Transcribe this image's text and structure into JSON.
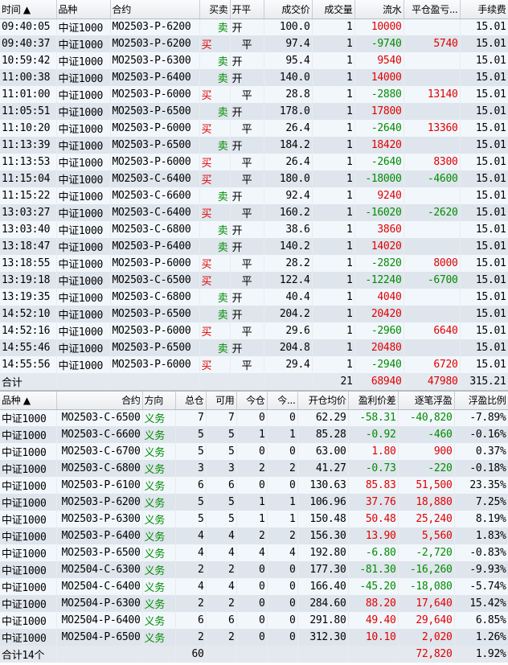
{
  "trades": {
    "headers": [
      "时间 ▲",
      "品种",
      "合约",
      "买卖",
      "开平",
      "成交价",
      "成交量",
      "流水",
      "平仓盈亏...",
      "手续费"
    ],
    "rows": [
      [
        "09:40:05",
        "中证1000",
        "MO2503-P-6200",
        "卖",
        "开",
        "100.0",
        "1",
        "10000",
        "",
        "15.01"
      ],
      [
        "09:40:37",
        "中证1000",
        "MO2503-P-6200",
        "买",
        "平",
        "97.4",
        "1",
        "-9740",
        "5740",
        "15.01"
      ],
      [
        "10:59:42",
        "中证1000",
        "MO2503-P-6300",
        "卖",
        "开",
        "95.4",
        "1",
        "9540",
        "",
        "15.01"
      ],
      [
        "11:00:38",
        "中证1000",
        "MO2503-P-6400",
        "卖",
        "开",
        "140.0",
        "1",
        "14000",
        "",
        "15.01"
      ],
      [
        "11:01:00",
        "中证1000",
        "MO2503-P-6000",
        "买",
        "平",
        "28.8",
        "1",
        "-2880",
        "13140",
        "15.01"
      ],
      [
        "11:05:51",
        "中证1000",
        "MO2503-P-6500",
        "卖",
        "开",
        "178.0",
        "1",
        "17800",
        "",
        "15.01"
      ],
      [
        "11:10:20",
        "中证1000",
        "MO2503-P-6000",
        "买",
        "平",
        "26.4",
        "1",
        "-2640",
        "13360",
        "15.01"
      ],
      [
        "11:13:39",
        "中证1000",
        "MO2503-P-6500",
        "卖",
        "开",
        "184.2",
        "1",
        "18420",
        "",
        "15.01"
      ],
      [
        "11:13:53",
        "中证1000",
        "MO2503-P-6000",
        "买",
        "平",
        "26.4",
        "1",
        "-2640",
        "8300",
        "15.01"
      ],
      [
        "11:15:04",
        "中证1000",
        "MO2503-C-6400",
        "买",
        "平",
        "180.0",
        "1",
        "-18000",
        "-4600",
        "15.01"
      ],
      [
        "11:15:22",
        "中证1000",
        "MO2503-C-6600",
        "卖",
        "开",
        "92.4",
        "1",
        "9240",
        "",
        "15.01"
      ],
      [
        "13:03:27",
        "中证1000",
        "MO2503-C-6400",
        "买",
        "平",
        "160.2",
        "1",
        "-16020",
        "-2620",
        "15.01"
      ],
      [
        "13:03:40",
        "中证1000",
        "MO2503-C-6800",
        "卖",
        "开",
        "38.6",
        "1",
        "3860",
        "",
        "15.01"
      ],
      [
        "13:18:47",
        "中证1000",
        "MO2503-P-6400",
        "卖",
        "开",
        "140.2",
        "1",
        "14020",
        "",
        "15.01"
      ],
      [
        "13:18:55",
        "中证1000",
        "MO2503-P-6000",
        "买",
        "平",
        "28.2",
        "1",
        "-2820",
        "8000",
        "15.01"
      ],
      [
        "13:19:18",
        "中证1000",
        "MO2503-C-6500",
        "买",
        "平",
        "122.4",
        "1",
        "-12240",
        "-6700",
        "15.01"
      ],
      [
        "13:19:35",
        "中证1000",
        "MO2503-C-6800",
        "卖",
        "开",
        "40.4",
        "1",
        "4040",
        "",
        "15.01"
      ],
      [
        "14:52:10",
        "中证1000",
        "MO2503-P-6500",
        "卖",
        "开",
        "204.2",
        "1",
        "20420",
        "",
        "15.01"
      ],
      [
        "14:52:16",
        "中证1000",
        "MO2503-P-6000",
        "买",
        "平",
        "29.6",
        "1",
        "-2960",
        "6640",
        "15.01"
      ],
      [
        "14:55:46",
        "中证1000",
        "MO2503-P-6500",
        "卖",
        "开",
        "204.8",
        "1",
        "20480",
        "",
        "15.01"
      ],
      [
        "14:55:56",
        "中证1000",
        "MO2503-P-6000",
        "买",
        "平",
        "29.4",
        "1",
        "-2940",
        "6720",
        "15.01"
      ]
    ],
    "total": [
      "合计",
      "",
      "",
      "",
      "",
      "",
      "21",
      "68940",
      "47980",
      "315.21"
    ]
  },
  "positions": {
    "headers": [
      "品种 ▲",
      "合约",
      "方向",
      "总仓",
      "可用",
      "今仓",
      "今...",
      "开仓均价",
      "盈利价差",
      "逐笔浮盈",
      "浮盈比例"
    ],
    "rows": [
      [
        "中证1000",
        "MO2503-C-6500",
        "义务",
        "7",
        "7",
        "0",
        "0",
        "62.29",
        "-58.31",
        "-40,820",
        "-7.89%"
      ],
      [
        "中证1000",
        "MO2503-C-6600",
        "义务",
        "5",
        "5",
        "1",
        "1",
        "85.28",
        "-0.92",
        "-460",
        "-0.16%"
      ],
      [
        "中证1000",
        "MO2503-C-6700",
        "义务",
        "5",
        "5",
        "0",
        "0",
        "63.00",
        "1.80",
        "900",
        "0.37%"
      ],
      [
        "中证1000",
        "MO2503-C-6800",
        "义务",
        "3",
        "3",
        "2",
        "2",
        "41.27",
        "-0.73",
        "-220",
        "-0.18%"
      ],
      [
        "中证1000",
        "MO2503-P-6100",
        "义务",
        "6",
        "6",
        "0",
        "0",
        "130.63",
        "85.83",
        "51,500",
        "23.35%"
      ],
      [
        "中证1000",
        "MO2503-P-6200",
        "义务",
        "5",
        "5",
        "1",
        "1",
        "106.96",
        "37.76",
        "18,880",
        "7.25%"
      ],
      [
        "中证1000",
        "MO2503-P-6300",
        "义务",
        "5",
        "5",
        "1",
        "1",
        "150.48",
        "50.48",
        "25,240",
        "8.19%"
      ],
      [
        "中证1000",
        "MO2503-P-6400",
        "义务",
        "4",
        "4",
        "2",
        "2",
        "156.30",
        "13.90",
        "5,560",
        "1.83%"
      ],
      [
        "中证1000",
        "MO2503-P-6500",
        "义务",
        "4",
        "4",
        "4",
        "4",
        "192.80",
        "-6.80",
        "-2,720",
        "-0.83%"
      ],
      [
        "中证1000",
        "MO2504-C-6300",
        "义务",
        "2",
        "2",
        "0",
        "0",
        "177.30",
        "-81.30",
        "-16,260",
        "-9.93%"
      ],
      [
        "中证1000",
        "MO2504-C-6400",
        "义务",
        "4",
        "4",
        "0",
        "0",
        "166.40",
        "-45.20",
        "-18,080",
        "-5.74%"
      ],
      [
        "中证1000",
        "MO2504-P-6300",
        "义务",
        "2",
        "2",
        "0",
        "0",
        "284.60",
        "88.20",
        "17,640",
        "15.42%"
      ],
      [
        "中证1000",
        "MO2504-P-6400",
        "义务",
        "6",
        "6",
        "0",
        "0",
        "291.80",
        "49.40",
        "29,640",
        "6.85%"
      ],
      [
        "中证1000",
        "MO2504-P-6500",
        "义务",
        "2",
        "2",
        "0",
        "0",
        "312.30",
        "10.10",
        "2,020",
        "1.26%"
      ]
    ],
    "total": [
      "合计14个",
      "",
      "",
      "60",
      "",
      "",
      "",
      "",
      "",
      "72,820",
      "1.92%"
    ]
  },
  "colors": {
    "up": "#e00000",
    "down": "#008c00"
  }
}
